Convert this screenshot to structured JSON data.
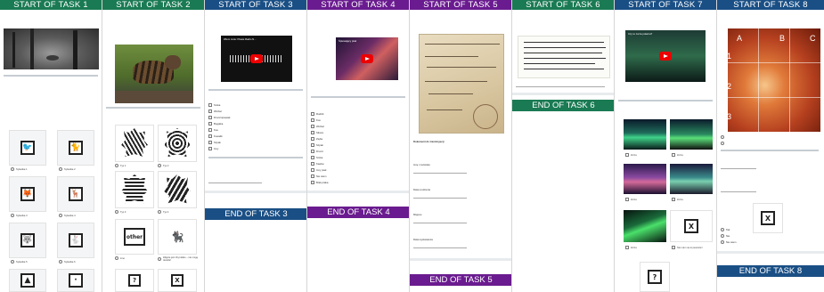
{
  "colors": {
    "task1": "#1a7a53",
    "task2": "#1a7a53",
    "task3": "#1a4f85",
    "task4": "#6a1b8f",
    "task5": "#6a1b8f",
    "task6": "#1a7a53",
    "task7": "#1a4f85",
    "task8": "#1a4f85",
    "end3": "#1a4f85",
    "end4": "#6a1b8f",
    "end5": "#6a1b8f",
    "end6": "#1a7a53",
    "end8": "#1a4f85"
  },
  "headers": {
    "t1": "START OF TASK 1",
    "t2": "START OF TASK 2",
    "t3": "START OF TASK 3",
    "t4": "START OF TASK 4",
    "t5": "START OF TASK 5",
    "t6": "START OF TASK 6",
    "t7": "START OF TASK 7",
    "t8": "START OF TASK 8"
  },
  "ends": {
    "e3": "END OF TASK 3",
    "e4": "END OF TASK 4",
    "e5": "END OF TASK 5",
    "e6": "END OF TASK 6",
    "e8": "END OF TASK 8"
  },
  "task1": {
    "card_labels": [
      "Sylwetka 1",
      "Sylwetka 2",
      "Sylwetka 3",
      "Sylwetka 4",
      "Sylwetka 5",
      "Sylwetka 6"
    ]
  },
  "task2": {
    "card_labels": [
      "Typ 1",
      "Typ 2",
      "Typ 3",
      "Typ 4",
      "inne",
      "Zdjęcie jest zbyt słabe – nie mogę określić"
    ],
    "other_tile": "other"
  },
  "task3": {
    "video_title": "Wiem mnie: Ptasie Radio N...",
    "options": [
      "Sroka",
      "Wróbel",
      "Drozd śpiewak",
      "Bogatka",
      "Kos",
      "Kowalik",
      "Szpak",
      "Inny"
    ]
  },
  "task4": {
    "video_title": "Śpiewający ptak",
    "options": [
      "Rudzik",
      "Kos",
      "Wróbel",
      "Sikora",
      "Zięba",
      "Szpak",
      "Drozd",
      "Sroka",
      "Kawka",
      "Inny ptak",
      "Nie wiem",
      "Brak ptaka"
    ]
  },
  "task5": {
    "doc_heading": "Dokument do transkrypcji",
    "fields": [
      "Imię i nazwisko",
      "Data urodzenia",
      "Miejsce",
      "Data wystawienia"
    ]
  },
  "task6": {
    "doc_heading": "Fragment do przepisania"
  },
  "task7": {
    "video_title": "Czy to zorza polarna?",
    "image_labels": [
      "Zorza",
      "Zorza",
      "Zorza",
      "Zorza",
      "Zorza",
      "Nie mam na to pewności"
    ],
    "x_tile": "X",
    "q_tile": "?"
  },
  "task8": {
    "grid_cols": [
      "A",
      "B",
      "C"
    ],
    "grid_rows": [
      "1",
      "2",
      "3"
    ],
    "options": [
      "Tak",
      "Nie",
      "Nie wiem"
    ],
    "x_tile": "X"
  }
}
